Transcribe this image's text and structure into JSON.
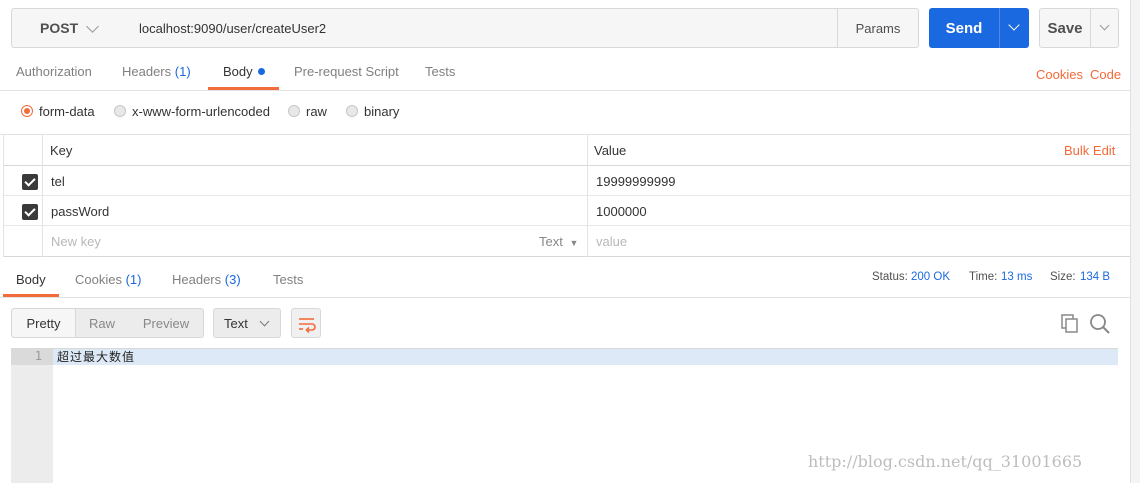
{
  "request": {
    "method": "POST",
    "url": "localhost:9090/user/createUser2",
    "params_label": "Params",
    "send_label": "Send",
    "save_label": "Save"
  },
  "request_tabs": {
    "authorization": "Authorization",
    "headers": "Headers",
    "headers_count": "(1)",
    "body": "Body",
    "prerequest": "Pre-request Script",
    "tests": "Tests",
    "cookies": "Cookies",
    "code": "Code"
  },
  "body_types": [
    "form-data",
    "x-www-form-urlencoded",
    "raw",
    "binary"
  ],
  "body_type_selected": "form-data",
  "form_table": {
    "key_header": "Key",
    "value_header": "Value",
    "bulk_edit": "Bulk Edit",
    "rows": [
      {
        "key": "tel",
        "value": "19999999999",
        "checked": true
      },
      {
        "key": "passWord",
        "value": "1000000",
        "checked": true
      }
    ],
    "new_key_placeholder": "New key",
    "new_value_placeholder": "value",
    "type_label": "Text"
  },
  "response_tabs": {
    "body": "Body",
    "cookies": "Cookies",
    "cookies_count": "(1)",
    "headers": "Headers",
    "headers_count": "(3)",
    "tests": "Tests"
  },
  "response_meta": {
    "status_label": "Status:",
    "status_value": "200 OK",
    "time_label": "Time:",
    "time_value": "13 ms",
    "size_label": "Size:",
    "size_value": "134 B"
  },
  "view_modes": [
    "Pretty",
    "Raw",
    "Preview"
  ],
  "format_label": "Text",
  "response_body": {
    "line_number": "1",
    "text": "超过最大数值"
  },
  "watermark": "http://blog.csdn.net/qq_31001665",
  "colors": {
    "accent": "#1b69e0",
    "tab_indicator": "#f26b3a"
  }
}
